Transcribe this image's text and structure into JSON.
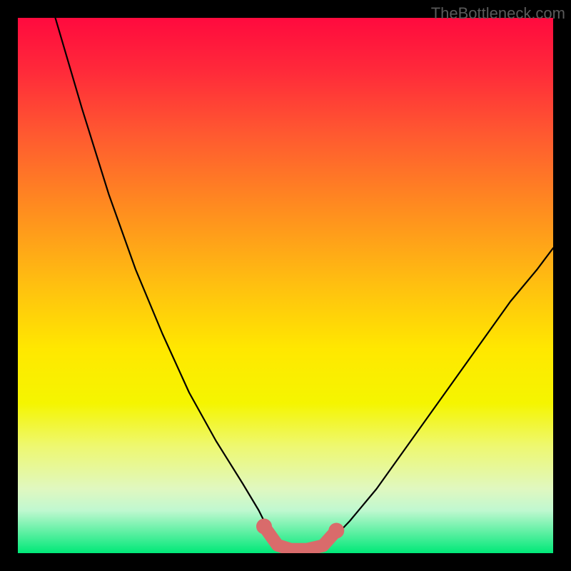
{
  "watermark": "TheBottleneck.com",
  "chart_data": {
    "type": "line",
    "title": "",
    "xlabel": "",
    "ylabel": "",
    "xlim": [
      0,
      100
    ],
    "ylim": [
      0,
      100
    ],
    "series": [
      {
        "name": "curve-left",
        "x": [
          7,
          12,
          17,
          22,
          27,
          32,
          37,
          42,
          45,
          47,
          48.5
        ],
        "y": [
          100,
          83,
          67,
          53,
          41,
          30,
          21,
          13,
          8,
          4,
          1.5
        ]
      },
      {
        "name": "flat-bottom",
        "x": [
          48.5,
          50,
          52,
          54,
          56,
          58
        ],
        "y": [
          1.5,
          0.8,
          0.6,
          0.6,
          1.0,
          1.8
        ]
      },
      {
        "name": "curve-right",
        "x": [
          58,
          62,
          67,
          72,
          77,
          82,
          87,
          92,
          97,
          100
        ],
        "y": [
          1.8,
          6,
          12,
          19,
          26,
          33,
          40,
          47,
          53,
          57
        ]
      },
      {
        "name": "highlight-band",
        "x": [
          46,
          48.5,
          51,
          54,
          57,
          59.5
        ],
        "y": [
          5,
          1.5,
          0.7,
          0.7,
          1.4,
          4.2
        ]
      }
    ],
    "highlight_points": [
      {
        "x": 46,
        "y": 5
      },
      {
        "x": 59.5,
        "y": 4.2
      }
    ]
  }
}
